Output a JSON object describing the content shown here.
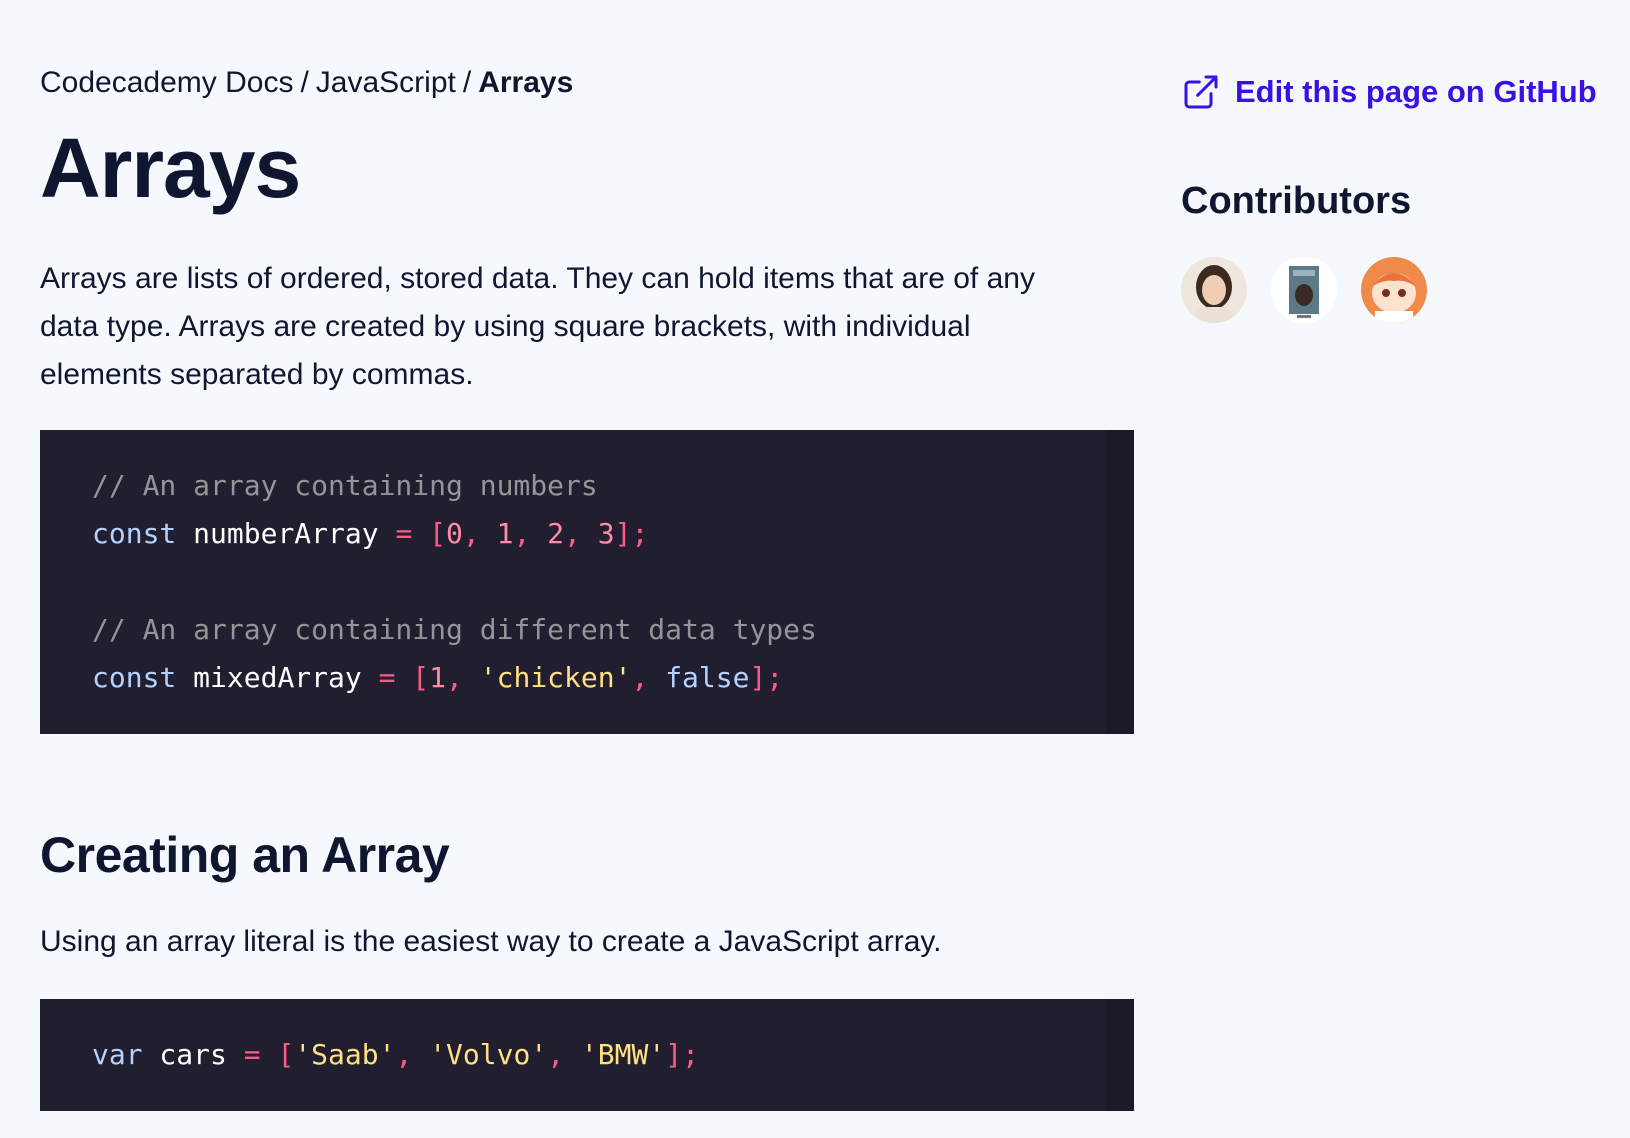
{
  "breadcrumb": {
    "items": [
      {
        "label": "Codecademy Docs"
      },
      {
        "label": "JavaScript"
      }
    ],
    "separator": "/",
    "current": "Arrays"
  },
  "page": {
    "title": "Arrays",
    "intro": "Arrays are lists of ordered, stored data. They can hold items that are of any data type. Arrays are created by using square brackets, with individual elements separated by commas."
  },
  "code_block_1": {
    "language": "javascript",
    "lines": [
      [
        {
          "t": "// An array containing numbers",
          "k": "comment"
        }
      ],
      [
        {
          "t": "const",
          "k": "keyword"
        },
        {
          "t": " numberArray ",
          "k": "ident"
        },
        {
          "t": "=",
          "k": "punct"
        },
        {
          "t": " [",
          "k": "punct"
        },
        {
          "t": "0",
          "k": "number"
        },
        {
          "t": ", ",
          "k": "punct"
        },
        {
          "t": "1",
          "k": "number"
        },
        {
          "t": ", ",
          "k": "punct"
        },
        {
          "t": "2",
          "k": "number"
        },
        {
          "t": ", ",
          "k": "punct"
        },
        {
          "t": "3",
          "k": "number"
        },
        {
          "t": "];",
          "k": "punct"
        }
      ],
      [],
      [
        {
          "t": "// An array containing different data types",
          "k": "comment"
        }
      ],
      [
        {
          "t": "const",
          "k": "keyword"
        },
        {
          "t": " mixedArray ",
          "k": "ident"
        },
        {
          "t": "=",
          "k": "punct"
        },
        {
          "t": " [",
          "k": "punct"
        },
        {
          "t": "1",
          "k": "number"
        },
        {
          "t": ", ",
          "k": "punct"
        },
        {
          "t": "'chicken'",
          "k": "string"
        },
        {
          "t": ", ",
          "k": "punct"
        },
        {
          "t": "false",
          "k": "bool"
        },
        {
          "t": "];",
          "k": "punct"
        }
      ]
    ]
  },
  "section": {
    "heading": "Creating an Array",
    "text": "Using an array literal is the easiest way to create a JavaScript array."
  },
  "code_block_2": {
    "language": "javascript",
    "lines": [
      [
        {
          "t": "var",
          "k": "keyword"
        },
        {
          "t": " cars ",
          "k": "ident"
        },
        {
          "t": "=",
          "k": "punct"
        },
        {
          "t": " [",
          "k": "punct"
        },
        {
          "t": "'Saab'",
          "k": "string"
        },
        {
          "t": ", ",
          "k": "punct"
        },
        {
          "t": "'Volvo'",
          "k": "string"
        },
        {
          "t": ", ",
          "k": "punct"
        },
        {
          "t": "'BMW'",
          "k": "string"
        },
        {
          "t": "];",
          "k": "punct"
        }
      ]
    ]
  },
  "sidebar": {
    "edit_link_label": "Edit this page on GitHub",
    "edit_icon": "external-link-icon",
    "contributors_title": "Contributors",
    "contributors": [
      {
        "avatar": "avatar-woman-photo"
      },
      {
        "avatar": "avatar-album-cover"
      },
      {
        "avatar": "avatar-anime-character"
      }
    ]
  },
  "colors": {
    "background": "#f5f9fd",
    "text": "#10162f",
    "link": "#3a10e5",
    "code_background": "#211e2f"
  }
}
